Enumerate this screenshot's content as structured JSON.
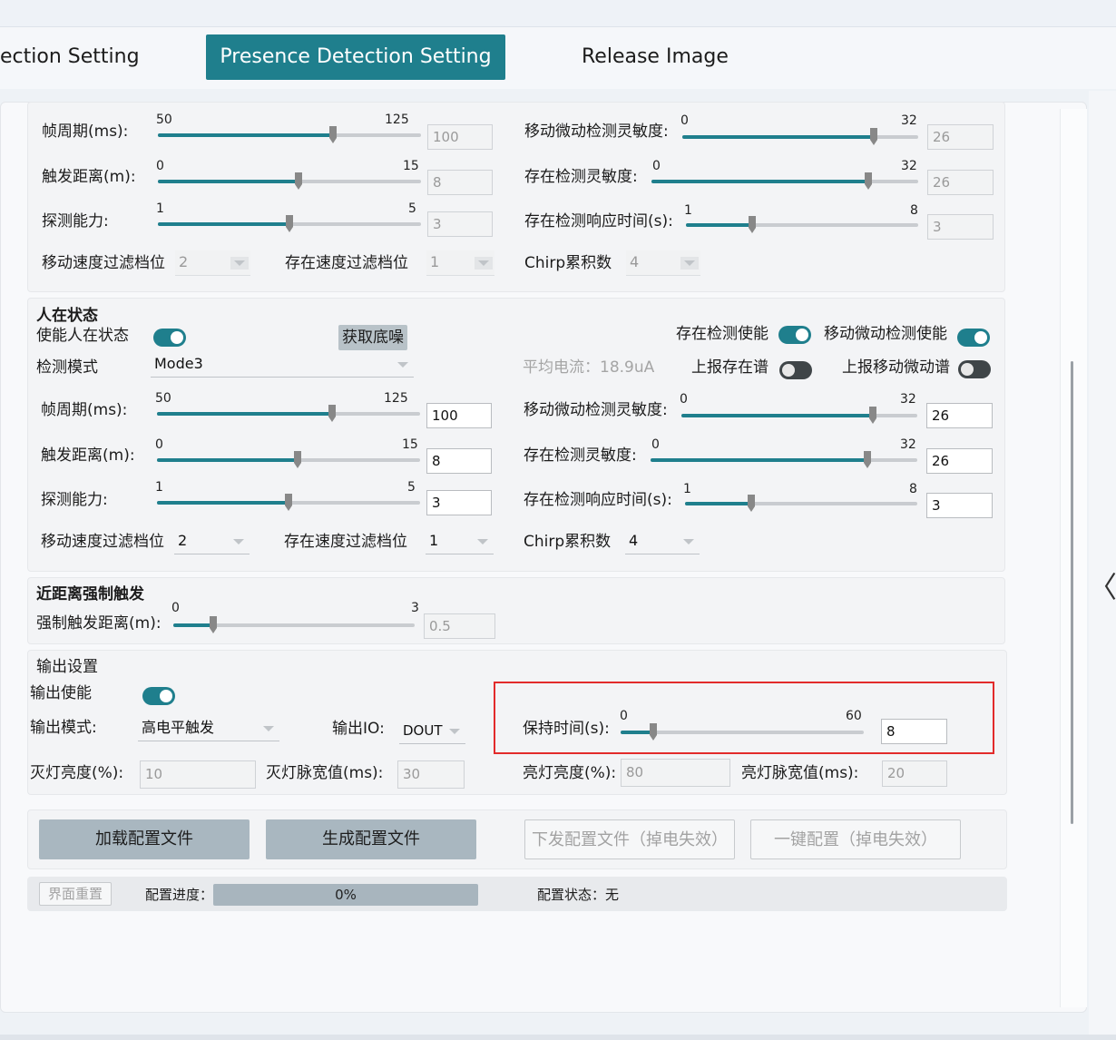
{
  "tabs": [
    {
      "label": "ection Setting",
      "active": false
    },
    {
      "label": "Presence Detection Setting",
      "active": true
    },
    {
      "label": "Release Image",
      "active": false
    }
  ],
  "colors": {
    "accent": "#1f7f8d",
    "highlight": "#e22b2b"
  },
  "disabled_section": {
    "frame_period": {
      "label": "帧周期(ms):",
      "min": "50",
      "max": "125",
      "value": "100",
      "level": 0.667
    },
    "trigger_distance": {
      "label": "触发距离(m):",
      "min": "0",
      "max": "15",
      "value": "8",
      "level": 0.533
    },
    "detection_ability": {
      "label": "探测能力:",
      "min": "1",
      "max": "5",
      "value": "3",
      "level": 0.5
    },
    "motion_sensitivity": {
      "label": "移动微动检测灵敏度:",
      "min": "0",
      "max": "32",
      "value": "26",
      "level": 0.8125
    },
    "presence_sensitivity": {
      "label": "存在检测灵敏度:",
      "min": "0",
      "max": "32",
      "value": "26",
      "level": 0.8125
    },
    "presence_response": {
      "label": "存在检测响应时间(s):",
      "min": "1",
      "max": "8",
      "value": "3",
      "level": 0.286
    },
    "motion_speed_filter": {
      "label": "移动速度过滤档位",
      "value": "2"
    },
    "presence_speed_filter": {
      "label": "存在速度过滤档位",
      "value": "1"
    },
    "chirp_accum": {
      "label": "Chirp累积数",
      "value": "4"
    }
  },
  "presence": {
    "title": "人在状态",
    "enable_label": "使能人在状态",
    "noise_button": "获取底噪",
    "presence_enable_label": "存在检测使能",
    "motion_enable_label": "移动微动检测使能",
    "mode_label": "检测模式",
    "mode_value": "Mode3",
    "avg_current": "平均电流：18.9uA",
    "report_presence": "上报存在谱",
    "report_motion": "上报移动微动谱",
    "frame_period": {
      "label": "帧周期(ms):",
      "min": "50",
      "max": "125",
      "value": "100",
      "level": 0.667
    },
    "trigger_distance": {
      "label": "触发距离(m):",
      "min": "0",
      "max": "15",
      "value": "8",
      "level": 0.533
    },
    "detection_ability": {
      "label": "探测能力:",
      "min": "1",
      "max": "5",
      "value": "3",
      "level": 0.5
    },
    "motion_sensitivity": {
      "label": "移动微动检测灵敏度:",
      "min": "0",
      "max": "32",
      "value": "26",
      "level": 0.8125
    },
    "presence_sensitivity": {
      "label": "存在检测灵敏度:",
      "min": "0",
      "max": "32",
      "value": "26",
      "level": 0.8125
    },
    "presence_response": {
      "label": "存在检测响应时间(s):",
      "min": "1",
      "max": "8",
      "value": "3",
      "level": 0.286
    },
    "motion_speed_filter": {
      "label": "移动速度过滤档位",
      "value": "2"
    },
    "presence_speed_filter": {
      "label": "存在速度过滤档位",
      "value": "1"
    },
    "chirp_accum": {
      "label": "Chirp累积数",
      "value": "4"
    }
  },
  "near_trigger": {
    "title": "近距离强制触发",
    "distance": {
      "label": "强制触发距离(m):",
      "min": "0",
      "max": "3",
      "value": "0.5",
      "level": 0.167
    }
  },
  "output": {
    "title": "输出设置",
    "enable_label": "输出使能",
    "mode_label": "输出模式:",
    "mode_value": "高电平触发",
    "io_label": "输出IO:",
    "io_value": "DOUT",
    "hold_time": {
      "label": "保持时间(s):",
      "min": "0",
      "max": "60",
      "value": "8",
      "level": 0.133
    },
    "off_brightness": {
      "label": "灭灯亮度(%):",
      "value": "10"
    },
    "off_pulse": {
      "label": "灭灯脉宽值(ms):",
      "value": "30"
    },
    "on_brightness": {
      "label": "亮灯亮度(%):",
      "value": "80"
    },
    "on_pulse": {
      "label": "亮灯脉宽值(ms):",
      "value": "20"
    }
  },
  "actions": {
    "load": "加载配置文件",
    "generate": "生成配置文件",
    "send": "下发配置文件（掉电失效）",
    "oneclick": "一键配置（掉电失效）"
  },
  "status": {
    "reset": "界面重置",
    "progress_label": "配置进度：",
    "progress_value": "0%",
    "state": "配置状态：无"
  }
}
